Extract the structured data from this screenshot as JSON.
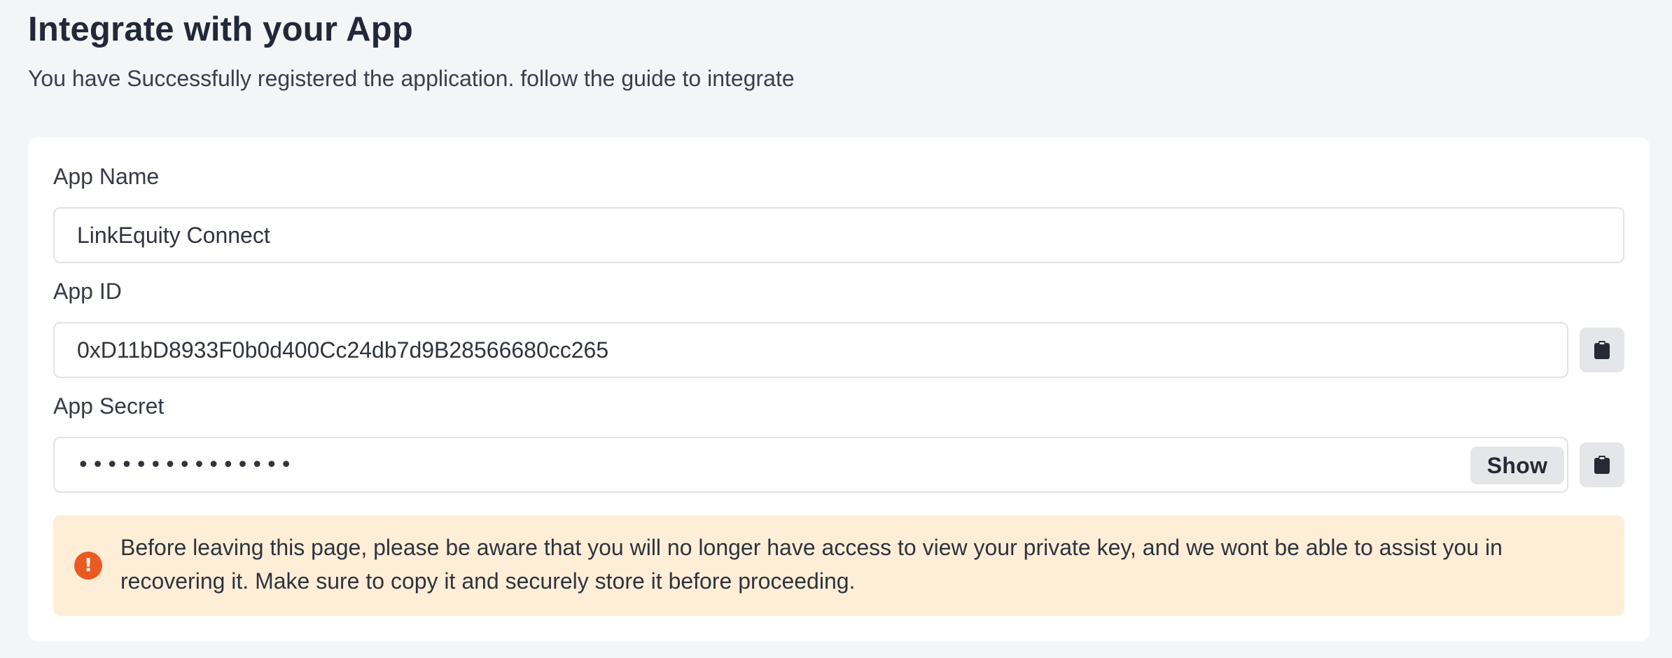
{
  "header": {
    "title": "Integrate with your App",
    "subtitle": "You have Successfully registered the application. follow the guide to integrate"
  },
  "form": {
    "app_name": {
      "label": "App Name",
      "value": "LinkEquity Connect"
    },
    "app_id": {
      "label": "App ID",
      "value": "0xD11bD8933F0b0d400Cc24db7d9B28566680cc265",
      "copy_icon": "clipboard-icon"
    },
    "app_secret": {
      "label": "App Secret",
      "masked_value": "•••••••••••••••",
      "show_label": "Show",
      "copy_icon": "clipboard-icon"
    }
  },
  "alert": {
    "icon": "exclamation-circle-icon",
    "icon_glyph": "!",
    "color": "#ec5a24",
    "background": "#ffeed7",
    "text": "Before leaving this page, please be aware that you will no longer have access to view your private key, and we wont be able to assist you in recovering it. Make sure to copy it and securely store it before proceeding."
  }
}
